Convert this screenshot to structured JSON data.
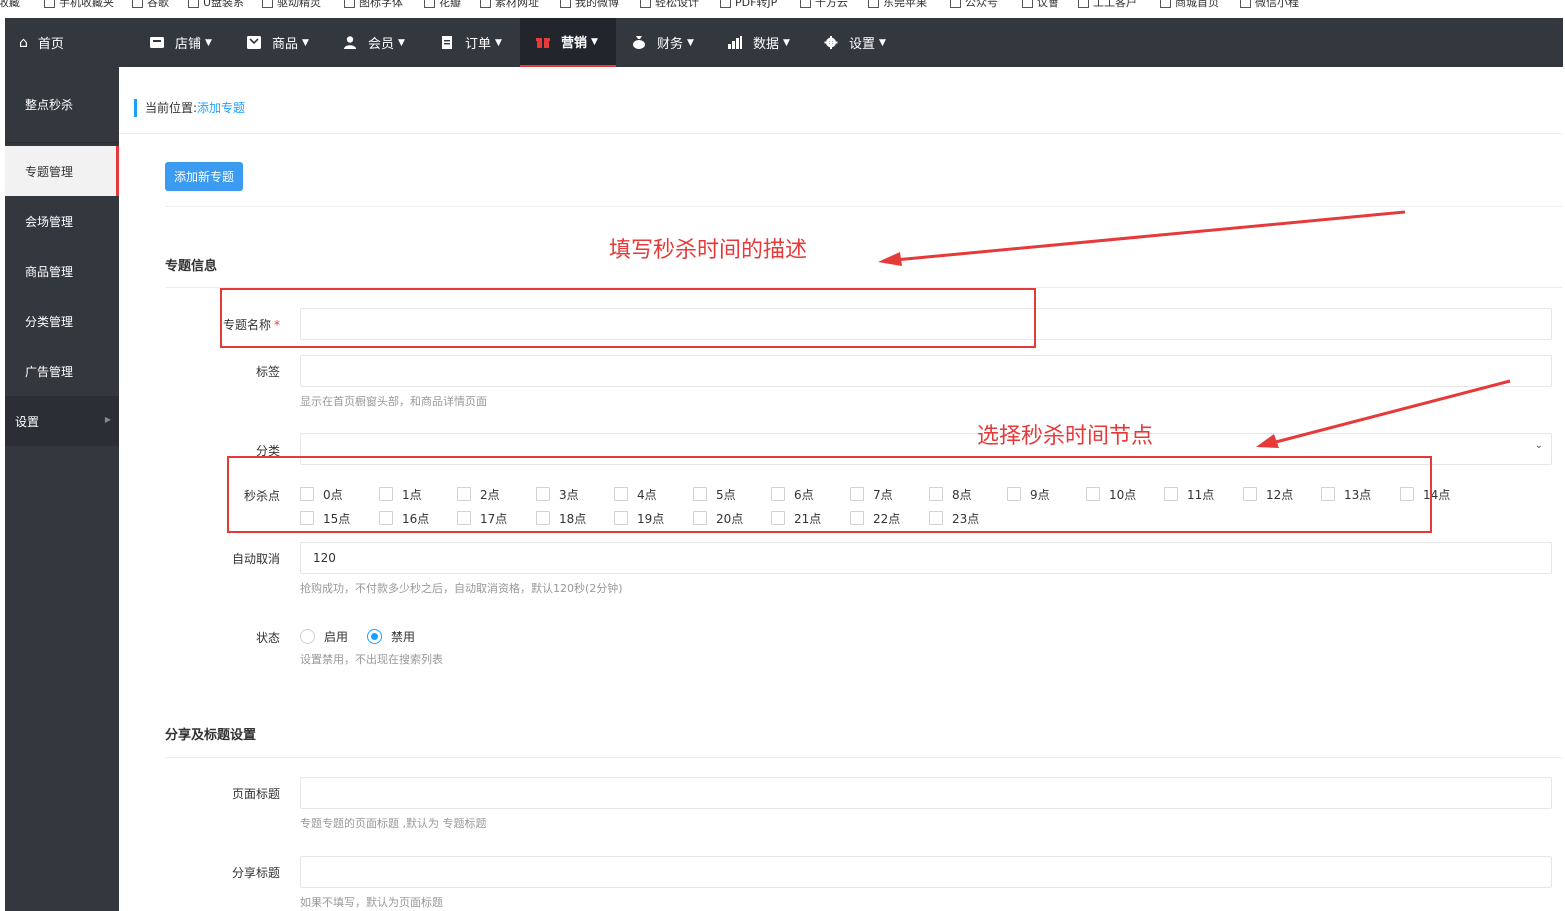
{
  "bookmarks": [
    "收藏",
    "手机收藏夹",
    "谷歌",
    "U盘装系",
    "驱动精灵",
    "图标字体",
    "花瓣",
    "素材网址",
    "我的微博",
    "轻松设计",
    "PDF转JP",
    "千方云",
    "东莞苹果",
    "公众号",
    "议會",
    "工工客户",
    "商城首页",
    "微信小程"
  ],
  "topnav": {
    "home": "首页",
    "items": [
      {
        "label": "店铺",
        "icon": "store-icon"
      },
      {
        "label": "商品",
        "icon": "goods-icon"
      },
      {
        "label": "会员",
        "icon": "user-icon"
      },
      {
        "label": "订单",
        "icon": "order-icon"
      },
      {
        "label": "营销",
        "icon": "gift-icon"
      },
      {
        "label": "财务",
        "icon": "money-bag-icon"
      },
      {
        "label": "数据",
        "icon": "chart-icon"
      },
      {
        "label": "设置",
        "icon": "gear-icon"
      }
    ],
    "active_index": 4,
    "accent": "#e63a3a"
  },
  "sidebar": {
    "title": "整点秒杀",
    "items": [
      "专题管理",
      "会场管理",
      "商品管理",
      "分类管理",
      "广告管理",
      "设置"
    ]
  },
  "breadcrumb": {
    "prefix": "当前位置:",
    "current": "添加专题"
  },
  "add_button": "添加新专题",
  "section_info": "专题信息",
  "fields": {
    "name_label": "专题名称",
    "required_mark": "*",
    "tag_label": "标签",
    "tag_help": "显示在首页橱窗头部，和商品详情页面",
    "category_label": "分类",
    "hours_label": "秒杀点",
    "hours": [
      "0点",
      "1点",
      "2点",
      "3点",
      "4点",
      "5点",
      "6点",
      "7点",
      "8点",
      "9点",
      "10点",
      "11点",
      "12点",
      "13点",
      "14点",
      "15点",
      "16点",
      "17点",
      "18点",
      "19点",
      "20点",
      "21点",
      "22点",
      "23点"
    ],
    "auto_cancel_label": "自动取消",
    "auto_cancel_value": "120",
    "auto_cancel_help": "抢购成功，不付款多少秒之后，自动取消资格，默认120秒(2分钟)",
    "status_label": "状态",
    "status_enable": "启用",
    "status_disable": "禁用",
    "status_selected": "禁用",
    "status_help": "设置禁用，不出现在搜索列表"
  },
  "section_share": "分享及标题设置",
  "share": {
    "page_title_label": "页面标题",
    "page_title_help": "专题专题的页面标题 ,默认为 专题标题",
    "share_title_label": "分享标题",
    "share_title_help": "如果不填写，默认为页面标题"
  },
  "annotations": {
    "desc": "填写秒杀时间的描述",
    "hours": "选择秒杀时间节点",
    "color": "#e63a3a"
  },
  "primary_color": "#1e9fff"
}
